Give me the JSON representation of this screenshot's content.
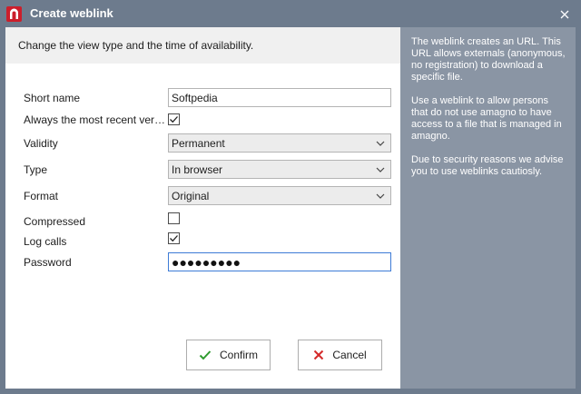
{
  "window": {
    "title": "Create weblink",
    "close_glyph": "×",
    "logo_icon": "amagno-logo-icon"
  },
  "header": {
    "description": "Change the view type and the time of availability."
  },
  "form": {
    "short_name": {
      "label": "Short name",
      "value": "Softpedia"
    },
    "most_recent": {
      "label": "Always the most recent ver…",
      "checked": true
    },
    "validity": {
      "label": "Validity",
      "value": "Permanent"
    },
    "type": {
      "label": "Type",
      "value": "In browser"
    },
    "format": {
      "label": "Format",
      "value": "Original"
    },
    "compressed": {
      "label": "Compressed",
      "checked": false
    },
    "log_calls": {
      "label": "Log calls",
      "checked": true
    },
    "password": {
      "label": "Password",
      "masked_value": "●●●●●●●●●"
    }
  },
  "buttons": {
    "confirm_label": "Confirm",
    "cancel_label": "Cancel",
    "confirm_color": "#2e9b2e",
    "cancel_color": "#d42a2a"
  },
  "side_panel": {
    "paragraphs": [
      "The weblink creates an URL. This URL allows externals (anonymous, no registration) to download a specific file.",
      "Use a weblink to allow persons that do not use amagno to have access to a file that is managed in amagno.",
      "Due to security reasons we advise you to use weblinks cautiosly."
    ]
  },
  "colors": {
    "frame": "#6d7b8d",
    "side_panel": "#8a95a4",
    "logo": "#cc1e2b",
    "focus_border": "#3d7bd6"
  }
}
